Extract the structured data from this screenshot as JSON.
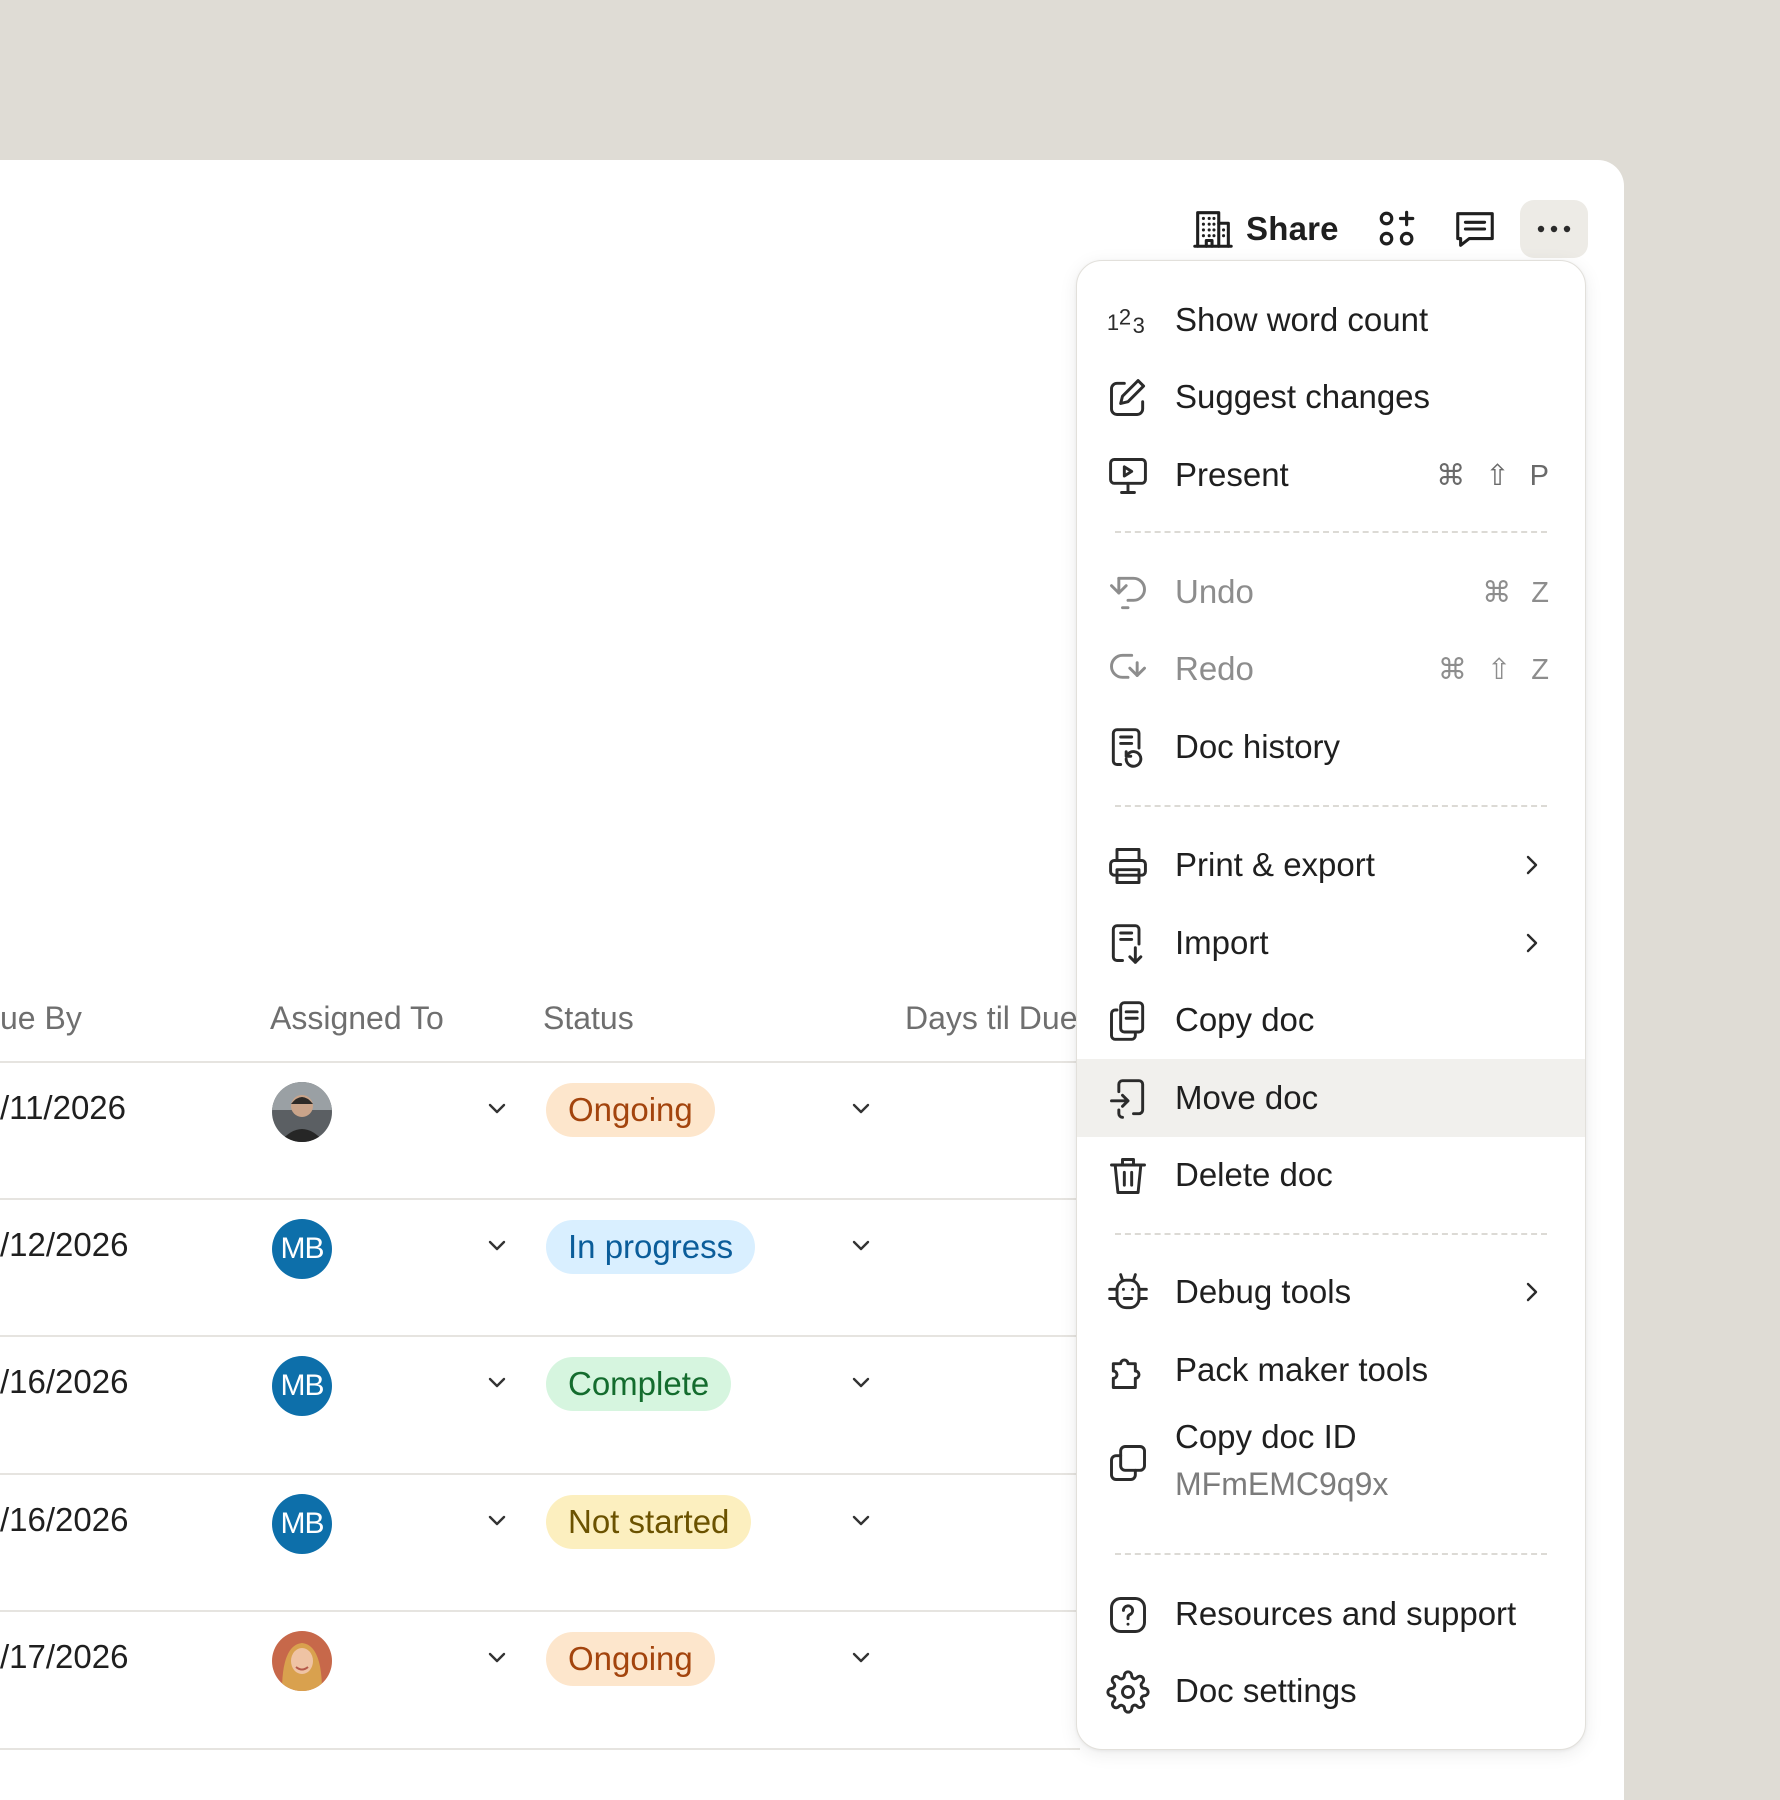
{
  "toolbar": {
    "share_label": "Share"
  },
  "table": {
    "headers": [
      "ue By",
      "Assigned To",
      "Status",
      "Days til Due"
    ],
    "rows": [
      {
        "date": "/11/2026",
        "assignee": "photo",
        "initials": "",
        "status": "Ongoing"
      },
      {
        "date": "/12/2026",
        "assignee": "initials",
        "initials": "MB",
        "status": "In progress"
      },
      {
        "date": "/16/2026",
        "assignee": "initials",
        "initials": "MB",
        "status": "Complete"
      },
      {
        "date": "/16/2026",
        "assignee": "initials",
        "initials": "MB",
        "status": "Not started"
      },
      {
        "date": "/17/2026",
        "assignee": "photo",
        "initials": "",
        "status": "Ongoing"
      }
    ]
  },
  "status_colors": {
    "Ongoing": {
      "bg": "#fde6cc",
      "fg": "#a3440d"
    },
    "In progress": {
      "bg": "#d9efff",
      "fg": "#0b5d9a"
    },
    "Complete": {
      "bg": "#d6f5df",
      "fg": "#146c2e"
    },
    "Not started": {
      "bg": "#fcefbf",
      "fg": "#6b5200"
    }
  },
  "menu": {
    "items": [
      {
        "label": "Show word count",
        "icon": "word-count-icon"
      },
      {
        "label": "Suggest changes",
        "icon": "suggest-edit-icon"
      },
      {
        "label": "Present",
        "icon": "present-icon",
        "shortcut": "⌘ ⇧ P"
      },
      {
        "label": "Undo",
        "icon": "undo-icon",
        "shortcut": "⌘ Z",
        "disabled": true
      },
      {
        "label": "Redo",
        "icon": "redo-icon",
        "shortcut": "⌘ ⇧ Z",
        "disabled": true
      },
      {
        "label": "Doc history",
        "icon": "doc-history-icon"
      },
      {
        "label": "Print & export",
        "icon": "printer-icon",
        "submenu": true
      },
      {
        "label": "Import",
        "icon": "import-icon",
        "submenu": true
      },
      {
        "label": "Copy doc",
        "icon": "copy-doc-icon"
      },
      {
        "label": "Move doc",
        "icon": "move-doc-icon",
        "highlighted": true
      },
      {
        "label": "Delete doc",
        "icon": "trash-icon"
      },
      {
        "label": "Debug tools",
        "icon": "bug-icon",
        "submenu": true
      },
      {
        "label": "Pack maker tools",
        "icon": "puzzle-icon"
      },
      {
        "label": "Copy doc ID",
        "sublabel": "MFmEMC9q9x",
        "icon": "copy-id-icon"
      },
      {
        "label": "Resources and support",
        "icon": "help-icon"
      },
      {
        "label": "Doc settings",
        "icon": "gear-icon"
      }
    ]
  }
}
